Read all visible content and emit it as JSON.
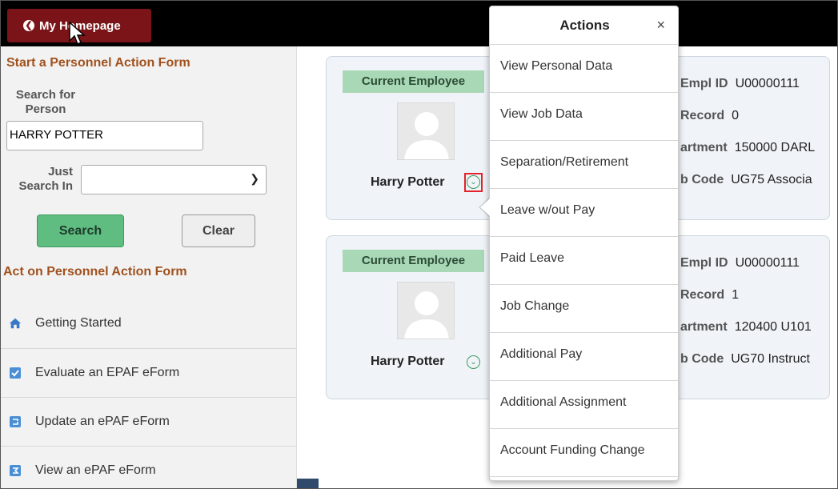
{
  "topbar": {
    "home_label": "My Homepage"
  },
  "left": {
    "start_title": "Start a Personnel Action Form",
    "search_for_label_1": "Search for",
    "search_for_label_2": "Person",
    "search_value": "HARRY POTTER",
    "just_label_1": "Just",
    "just_label_2": "Search In",
    "select_value": "",
    "search_button": "Search",
    "clear_button": "Clear",
    "act_title": "Act on Personnel Action Form",
    "nav": [
      {
        "label": "Getting Started",
        "icon": "home-icon"
      },
      {
        "label": "Evaluate an EPAF eForm",
        "icon": "evaluate-form-icon"
      },
      {
        "label": "Update an ePAF eForm",
        "icon": "update-form-icon"
      },
      {
        "label": "View an ePAF eForm",
        "icon": "view-form-icon"
      }
    ]
  },
  "cards": [
    {
      "badge": "Current Employee",
      "name": "Harry Potter",
      "empl_id_label": "Empl ID",
      "empl_id": "U00000111",
      "record_label": "Record",
      "record": "0",
      "dept_label": "artment",
      "dept": "150000  DARL",
      "job_label": "b Code",
      "job": "UG75  Associa"
    },
    {
      "badge": "Current Employee",
      "name": "Harry Potter",
      "empl_id_label": "Empl ID",
      "empl_id": "U00000111",
      "record_label": "Record",
      "record": "1",
      "dept_label": "artment",
      "dept": "120400  U101",
      "job_label": "b Code",
      "job": "UG70  Instruct"
    }
  ],
  "actions": {
    "title": "Actions",
    "close": "×",
    "items": [
      "View Personal Data",
      "View Job Data",
      "Separation/Retirement",
      "Leave w/out Pay",
      "Paid Leave",
      "Job Change",
      "Additional Pay",
      "Additional Assignment",
      "Account Funding Change"
    ]
  },
  "colors": {
    "home_button": "#7a1418",
    "section_title": "#a0521e",
    "search_button": "#5fbd81",
    "badge": "#a8d8b6",
    "highlight": "#e2232a"
  }
}
